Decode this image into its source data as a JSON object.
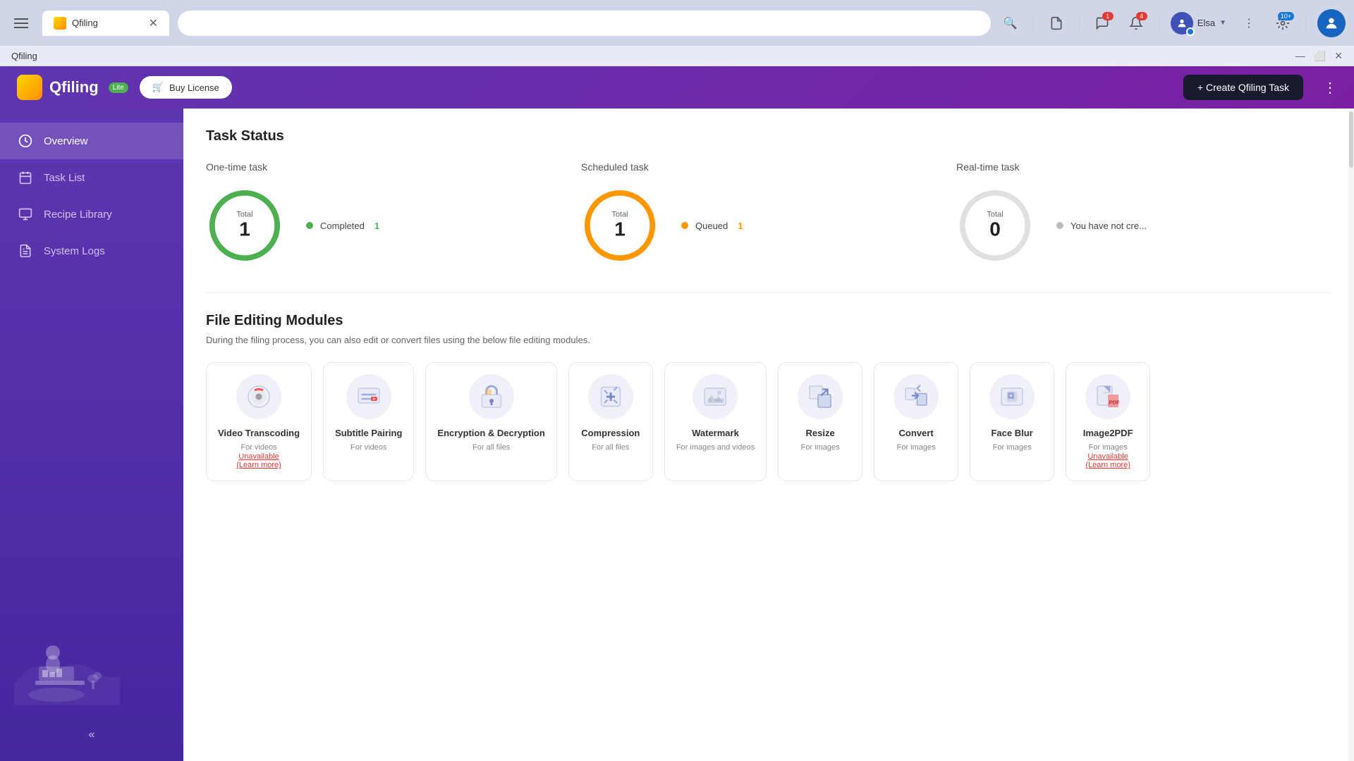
{
  "browser": {
    "tab_title": "Qfiling",
    "app_title": "Qfiling"
  },
  "app": {
    "name": "Qfiling",
    "badge": "Lite",
    "buy_license": "Buy License",
    "create_task": "+ Create Qfiling Task"
  },
  "sidebar": {
    "items": [
      {
        "id": "overview",
        "label": "Overview",
        "active": true
      },
      {
        "id": "task-list",
        "label": "Task List",
        "active": false
      },
      {
        "id": "recipe-library",
        "label": "Recipe Library",
        "active": false
      },
      {
        "id": "system-logs",
        "label": "System Logs",
        "active": false
      }
    ],
    "collapse_label": "«"
  },
  "task_status": {
    "section_title": "Task Status",
    "one_time": {
      "label": "One-time task",
      "total_label": "Total",
      "total": "1",
      "legend": [
        {
          "label": "Completed",
          "count": "1",
          "color": "#4caf50"
        }
      ]
    },
    "scheduled": {
      "label": "Scheduled task",
      "total_label": "Total",
      "total": "1",
      "legend": [
        {
          "label": "Queued",
          "count": "1",
          "color": "#ff9800"
        }
      ]
    },
    "realtime": {
      "label": "Real-time task",
      "total_label": "Total",
      "total": "0",
      "legend": [
        {
          "label": "You have not cre...",
          "count": "",
          "color": "#bbb"
        }
      ]
    }
  },
  "modules": {
    "title": "File Editing Modules",
    "desc": "During the filing process, you can also edit or convert files using the below file editing modules.",
    "items": [
      {
        "id": "video-transcoding",
        "name": "Video Transcoding",
        "sub": "For videos",
        "unavailable": true,
        "unavailable_text": "Unavailable",
        "learn_more": "(Learn more)",
        "icon": "🎥"
      },
      {
        "id": "subtitle-pairing",
        "name": "Subtitle Pairing",
        "sub": "For videos",
        "unavailable": false,
        "icon": "🎬"
      },
      {
        "id": "encryption-decryption",
        "name": "Encryption & Decryption",
        "sub": "For all files",
        "unavailable": false,
        "icon": "🔐"
      },
      {
        "id": "compression",
        "name": "Compression",
        "sub": "For all files",
        "unavailable": false,
        "icon": "🗜️"
      },
      {
        "id": "watermark",
        "name": "Watermark",
        "sub": "For images and videos",
        "unavailable": false,
        "icon": "🖼️"
      },
      {
        "id": "resize",
        "name": "Resize",
        "sub": "For images",
        "unavailable": false,
        "icon": "✂️"
      },
      {
        "id": "convert",
        "name": "Convert",
        "sub": "For images",
        "unavailable": false,
        "icon": "🔄"
      },
      {
        "id": "face-blur",
        "name": "Face Blur",
        "sub": "For images",
        "unavailable": false,
        "icon": "👤"
      },
      {
        "id": "image2pdf",
        "name": "Image2PDF",
        "sub": "For images",
        "unavailable": true,
        "unavailable_text": "Unavailable",
        "learn_more": "(Learn more)",
        "icon": "📄"
      }
    ]
  },
  "browser_actions": {
    "search": "🔍",
    "docs": "📄",
    "message_badge": "1",
    "bell_badge": "4",
    "user_name": "Elsa",
    "more_badge": "10+",
    "extensions_badge": "10+"
  }
}
